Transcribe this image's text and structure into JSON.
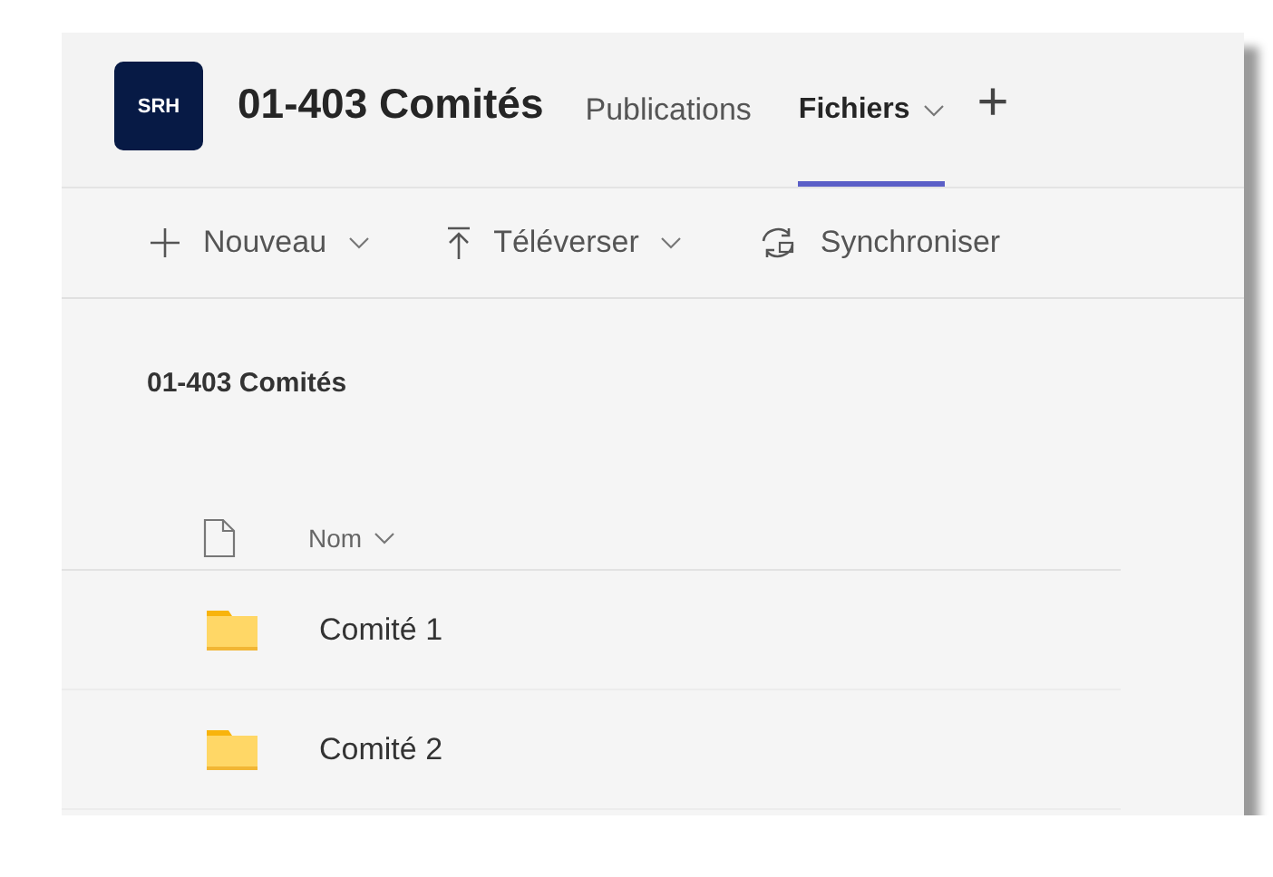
{
  "team": {
    "logo": "SRH",
    "name": "01-403 Comités"
  },
  "tabs": [
    {
      "label": "Publications",
      "selected": false,
      "dropdown": false
    },
    {
      "label": "Fichiers",
      "selected": true,
      "dropdown": true
    }
  ],
  "add_tab": "+",
  "toolbar": [
    {
      "kind": "new",
      "label": "Nouveau",
      "dropdown": true
    },
    {
      "kind": "upload",
      "label": "Téléverser",
      "dropdown": true
    },
    {
      "kind": "sync",
      "label": "Synchroniser",
      "dropdown": false
    }
  ],
  "breadcrumb": "01-403 Comités",
  "table": {
    "columns": [
      {
        "label": "Nom",
        "sortable": true
      }
    ],
    "rows": [
      {
        "kind": "folder",
        "name": "Comité 1"
      },
      {
        "kind": "folder",
        "name": "Comité 2"
      }
    ]
  }
}
